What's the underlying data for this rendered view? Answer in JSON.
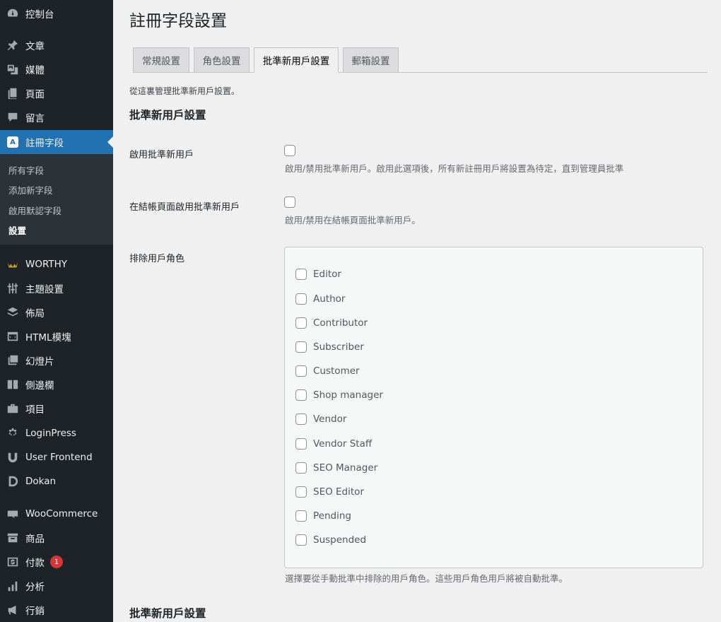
{
  "sidebar": {
    "menu": [
      {
        "id": "dashboard",
        "label": "控制台",
        "icon": "dashboard-icon"
      },
      {
        "id": "posts",
        "label": "文章",
        "icon": "pin-icon"
      },
      {
        "id": "media",
        "label": "媒體",
        "icon": "media-icon"
      },
      {
        "id": "pages",
        "label": "頁面",
        "icon": "page-icon"
      },
      {
        "id": "comments",
        "label": "留言",
        "icon": "comment-icon"
      },
      {
        "id": "reg-fields",
        "label": "註冊字段",
        "icon": "registration-icon"
      }
    ],
    "submenu": [
      {
        "label": "所有字段"
      },
      {
        "label": "添加新字段"
      },
      {
        "label": "啟用默認字段"
      },
      {
        "label": "設置"
      }
    ],
    "menu2": [
      {
        "label": "WORTHY",
        "icon": "worthy-icon"
      },
      {
        "label": "主題設置",
        "icon": "sliders-icon"
      },
      {
        "label": "佈局",
        "icon": "layers-icon"
      },
      {
        "label": "HTML模塊",
        "icon": "code-icon"
      },
      {
        "label": "幻燈片",
        "icon": "slides-icon"
      },
      {
        "label": "側邊欄",
        "icon": "sidebar-icon"
      },
      {
        "label": "項目",
        "icon": "briefcase-icon"
      },
      {
        "label": "LoginPress",
        "icon": "gear-icon"
      },
      {
        "label": "User Frontend",
        "icon": "user-frontend-icon"
      },
      {
        "label": "Dokan",
        "icon": "dokan-icon"
      },
      {
        "label": "WooCommerce",
        "icon": "woocommerce-icon"
      },
      {
        "label": "商品",
        "icon": "archive-icon"
      },
      {
        "label": "付款",
        "icon": "dollar-icon",
        "badge": "1"
      },
      {
        "label": "分析",
        "icon": "bar-chart-icon"
      },
      {
        "label": "行銷",
        "icon": "megaphone-icon"
      }
    ]
  },
  "main": {
    "title": "註冊字段設置",
    "tabs": [
      {
        "label": "常規設置"
      },
      {
        "label": "角色設置"
      },
      {
        "label": "批準新用戶設置"
      },
      {
        "label": "郵箱設置"
      }
    ],
    "intro": "從這裏管理批準新用戶設置。",
    "section_title": "批準新用戶設置",
    "fields": {
      "enable": {
        "label": "啟用批準新用戶",
        "desc": "啟用/禁用批準新用戶。啟用此選項後，所有新註冊用戶將設置為待定，直到管理員批準"
      },
      "checkout": {
        "label": "在結帳頁面啟用批準新用戶",
        "desc": "啟用/禁用在結帳頁面批準新用戶。"
      },
      "exclude": {
        "label": "排除用戶角色",
        "desc": "選擇要從手動批準中排除的用戶角色。這些用戶角色用戶將被自動批準。"
      }
    },
    "roles": [
      {
        "label": "Editor"
      },
      {
        "label": "Author"
      },
      {
        "label": "Contributor"
      },
      {
        "label": "Subscriber"
      },
      {
        "label": "Customer"
      },
      {
        "label": "Shop manager"
      },
      {
        "label": "Vendor"
      },
      {
        "label": "Vendor Staff"
      },
      {
        "label": "SEO Manager"
      },
      {
        "label": "SEO Editor"
      },
      {
        "label": "Pending"
      },
      {
        "label": "Suspended"
      }
    ],
    "section_title_2": "批準新用戶設置"
  },
  "colors": {
    "sidebar_bg": "#1d2327",
    "accent": "#2271b1",
    "badge": "#d63638"
  }
}
